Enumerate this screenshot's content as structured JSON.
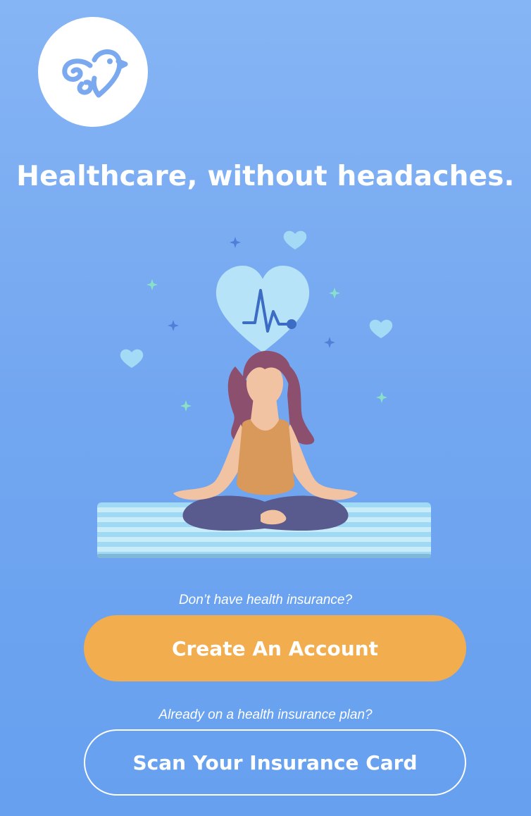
{
  "brand": {
    "logo_icon": "bird-heart-logo-icon"
  },
  "headline": "Healthcare, without headaches.",
  "illustration": {
    "subject": "woman-meditating-illustration",
    "icons": [
      "heart-monitor-icon",
      "heart-icon",
      "sparkle-icon",
      "yoga-mat"
    ]
  },
  "signup": {
    "prompt": "Don’t have health insurance?",
    "button_label": "Create An Account"
  },
  "scan": {
    "prompt": "Already on a health insurance plan?",
    "button_label": "Scan Your Insurance Card"
  },
  "colors": {
    "background_top": "#86b5f5",
    "background_bottom": "#66a0ef",
    "primary_button": "#f2ad4e",
    "logo_stroke": "#7aa9ef"
  }
}
